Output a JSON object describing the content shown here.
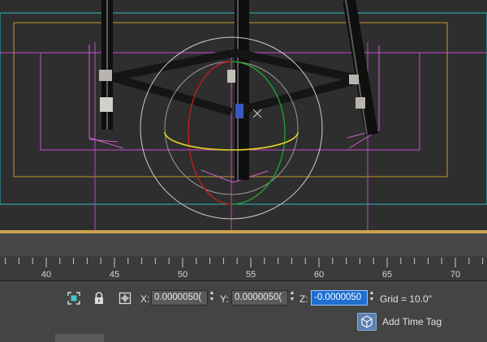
{
  "viewport": {
    "name": "perspective viewport"
  },
  "timeline": {
    "ticks": [
      "40",
      "45",
      "50",
      "55",
      "60",
      "65",
      "70"
    ]
  },
  "status_bar": {
    "selection_icon": "selection-bracket-icon",
    "lock_icon": "padlock-icon",
    "coord_mode_icon": "absolute-mode-transform-icon",
    "x_label": "X:",
    "x_value": "0.0000050(",
    "y_label": "Y:",
    "y_value": "0.0000050(",
    "z_label": "Z:",
    "z_value": "-0.0000050",
    "grid": "Grid = 10.0\"",
    "time_tag_icon": "time-tag-cube-icon",
    "time_tag_label": "Add Time Tag"
  },
  "colors": {
    "viewport_bg": "#2e2e2e",
    "active_field": "#1e6fd0",
    "viewport_border": "#c9a24a"
  }
}
